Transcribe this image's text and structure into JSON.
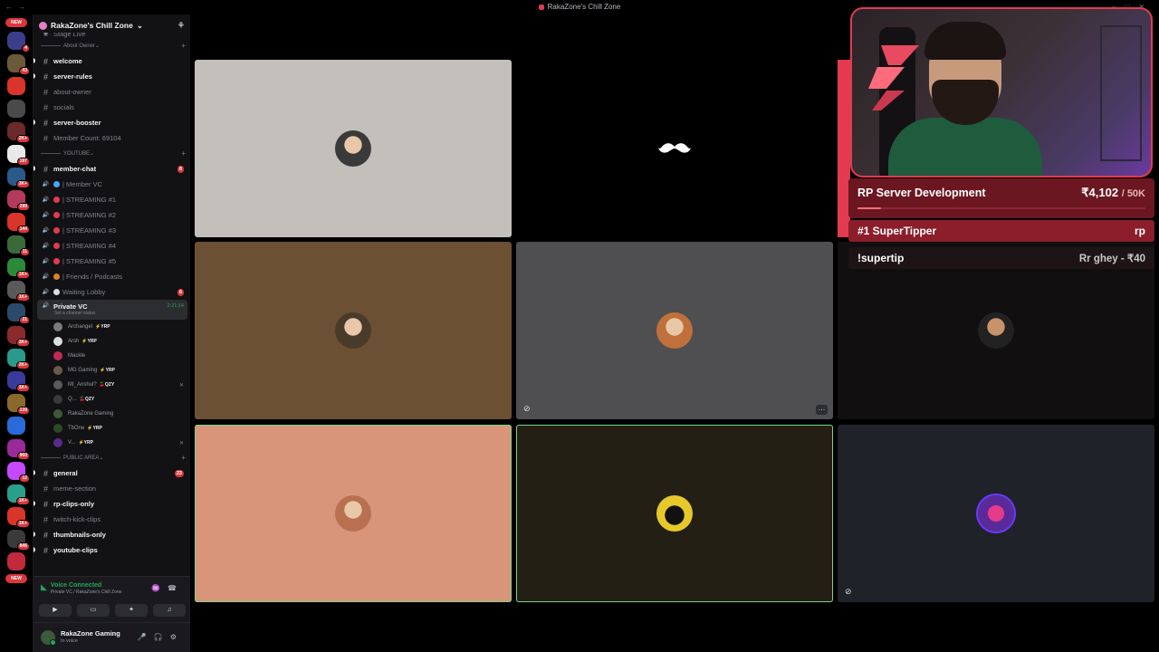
{
  "window": {
    "title": "RakaZone's Chill Zone"
  },
  "servers": {
    "new_top": "NEW",
    "new_bottom": "NEW",
    "items": [
      {
        "badge": "4",
        "color": "#3b3f8a"
      },
      {
        "badge": "43",
        "color": "#6a5a3a"
      },
      {
        "badge": "",
        "color": "#d9352a"
      },
      {
        "badge": "",
        "color": "#4a4a4a"
      },
      {
        "badge": "2K+",
        "color": "#6a2a2a"
      },
      {
        "badge": "197",
        "color": "#e9e9e9"
      },
      {
        "badge": "3K+",
        "color": "#2a5a8a"
      },
      {
        "badge": "299",
        "color": "#b23a5a"
      },
      {
        "badge": "144",
        "color": "#d9352a"
      },
      {
        "badge": "11",
        "color": "#3a6a3a"
      },
      {
        "badge": "1K+",
        "color": "#2a8a3a"
      },
      {
        "badge": "1K+",
        "color": "#5a5a5a"
      },
      {
        "badge": "21",
        "color": "#2a4a6a"
      },
      {
        "badge": "3K+",
        "color": "#8a2a2a"
      },
      {
        "badge": "2K+",
        "color": "#2a9a8a"
      },
      {
        "badge": "1K+",
        "color": "#3a3a9a"
      },
      {
        "badge": "139",
        "color": "#8a6a2a"
      },
      {
        "badge": "",
        "color": "#2a6ad9"
      },
      {
        "badge": "960",
        "color": "#9a2a9a"
      },
      {
        "badge": "12",
        "color": "#c54aff"
      },
      {
        "badge": "1K+",
        "color": "#2aa08a"
      },
      {
        "badge": "1K+",
        "color": "#d9352a"
      },
      {
        "badge": "846",
        "color": "#3a3a3a"
      },
      {
        "badge": "",
        "color": "#c02a3a"
      }
    ]
  },
  "server": {
    "name": "RakaZone's Chill Zone"
  },
  "sidebar": {
    "stage": "Stage Live",
    "cat_about": "About Owner",
    "about": [
      {
        "name": "welcome",
        "unread": true
      },
      {
        "name": "server-rules",
        "unread": true
      },
      {
        "name": "about-owner",
        "unread": false
      },
      {
        "name": "socials",
        "unread": false
      },
      {
        "name": "server-booster",
        "unread": true
      },
      {
        "name": "Member Count: 69104",
        "unread": false
      }
    ],
    "cat_youtube": "YOUTUBE",
    "member_chat": "member-chat",
    "member_chat_count": "8",
    "voice": [
      {
        "name": "| Member VC",
        "color": "#4aa3ff"
      },
      {
        "name": "| STREAMING #1",
        "color": "#e23b4f"
      },
      {
        "name": "| STREAMING #2",
        "color": "#e23b4f"
      },
      {
        "name": "| STREAMING #3",
        "color": "#e23b4f"
      },
      {
        "name": "| STREAMING #4",
        "color": "#e23b4f"
      },
      {
        "name": "| STREAMING #5",
        "color": "#e23b4f"
      },
      {
        "name": "| Friends / Podcasts",
        "color": "#d9822b"
      },
      {
        "name": "Waiting Lobby",
        "color": "#dbdee1"
      }
    ],
    "waiting_count": "6",
    "private_vc": {
      "name": "Private VC",
      "status": "Set a channel status",
      "time": "2:21:14"
    },
    "members": [
      {
        "name": "Archangel",
        "tag": "⚡YRP",
        "color": "#7a7a7a"
      },
      {
        "name": "Arsh",
        "tag": "⚡YRP",
        "color": "#dbdee1"
      },
      {
        "name": "Mackle",
        "tag": "",
        "color": "#c02a5a"
      },
      {
        "name": "MG Gaming",
        "tag": "⚡YRP",
        "color": "#6a5a4a"
      },
      {
        "name": "MI_Anshul?",
        "tag": "🍒QZY",
        "color": "#5a5a5a"
      },
      {
        "name": "Q...",
        "tag": "🍒QZY",
        "color": "#3a3a3a"
      },
      {
        "name": "RakaZone Gaming",
        "tag": "",
        "color": "#3a5a3a"
      },
      {
        "name": "TbOne",
        "tag": "⚡YRP",
        "color": "#2a4a2a"
      },
      {
        "name": "V...",
        "tag": "⚡YRP",
        "color": "#5a2a8a"
      }
    ],
    "cat_public": "PUBLIC AREA",
    "general": "general",
    "general_count": "23",
    "public": [
      {
        "name": "meme-section",
        "unread": false
      },
      {
        "name": "rp-clips-only",
        "unread": true
      },
      {
        "name": "twitch-kick-clips",
        "unread": false
      },
      {
        "name": "thumbnails-only",
        "unread": true
      },
      {
        "name": "youtube-clips",
        "unread": true
      }
    ]
  },
  "voice_panel": {
    "status": "Voice Connected",
    "location": "Private VC / RakaZone's Chill Zone"
  },
  "user": {
    "name": "RakaZone Gaming",
    "status": "In voice"
  },
  "tiles": [
    {
      "bg": "#c3bfbb",
      "avatar": "#3a3a3a",
      "speaking": false
    },
    {
      "bg": "#000000",
      "avatar": "#000000",
      "speaking": false
    },
    {
      "bg": "#6b5034",
      "avatar": "#4a3a2a",
      "speaking": false
    },
    {
      "bg": "#4f4f52",
      "avatar": "#c0703a",
      "speaking": false
    },
    {
      "bg": "#110f10",
      "avatar": "#1a1a1a",
      "speaking": false
    },
    {
      "bg": "#d8957a",
      "avatar": "#b87050",
      "speaking": true
    },
    {
      "bg": "#241f14",
      "avatar": "#e6c82a",
      "speaking": true
    },
    {
      "bg": "#1f2228",
      "avatar": "#5a2a9a",
      "speaking": false
    }
  ],
  "overlay": {
    "goal_title": "RP Server Development",
    "goal_amount": "₹4,102",
    "goal_target": "/ 50K",
    "goal_progress": 0.082,
    "tipper_label": "#1 SuperTipper",
    "tipper_name": "rp",
    "supertip_label": "!supertip",
    "supertip_value": "Rr ghey - ₹40"
  }
}
